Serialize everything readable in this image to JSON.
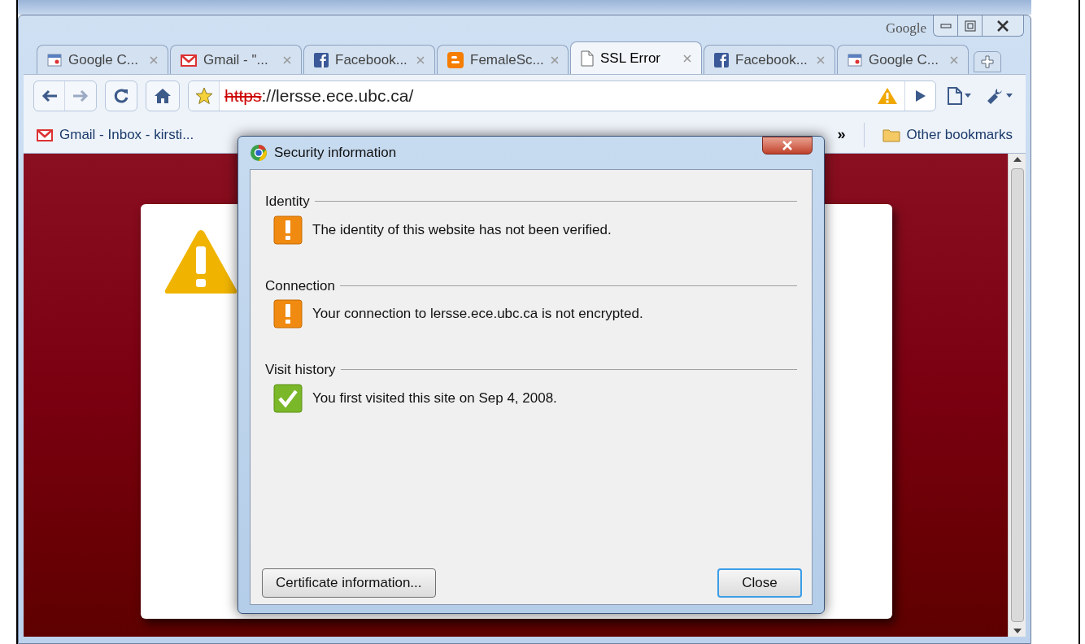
{
  "window": {
    "title": "Google"
  },
  "tabs": [
    {
      "label": "Google C...",
      "kind": "calendar",
      "selected": false
    },
    {
      "label": "Gmail - \"...",
      "kind": "gmail",
      "selected": false
    },
    {
      "label": "Facebook...",
      "kind": "facebook",
      "selected": false
    },
    {
      "label": "FemaleSc...",
      "kind": "blogger",
      "selected": false
    },
    {
      "label": "SSL Error",
      "kind": "page",
      "selected": true
    },
    {
      "label": "Facebook...",
      "kind": "facebook",
      "selected": false
    },
    {
      "label": "Google C...",
      "kind": "calendar",
      "selected": false
    }
  ],
  "address": {
    "scheme": "https",
    "rest": "://lersse.ece.ubc.ca/",
    "scheme_struck": true
  },
  "bookmarks": [
    {
      "label": "Gmail - Inbox - kirsti...",
      "kind": "gmail"
    }
  ],
  "bookmarks_overflow": "»",
  "other_bookmarks": "Other bookmarks",
  "dialog": {
    "title": "Security information",
    "sections": [
      {
        "heading": "Identity",
        "message": "The identity of this website has not been verified.",
        "kind": "warning"
      },
      {
        "heading": "Connection",
        "message": "Your connection to lersse.ece.ubc.ca is not encrypted.",
        "kind": "warning"
      },
      {
        "heading": "Visit history",
        "message": "You first visited this site on Sep 4, 2008.",
        "kind": "ok"
      }
    ],
    "buttons": [
      {
        "label": "Certificate information...",
        "default": false
      },
      {
        "label": "Close",
        "default": true
      }
    ]
  }
}
